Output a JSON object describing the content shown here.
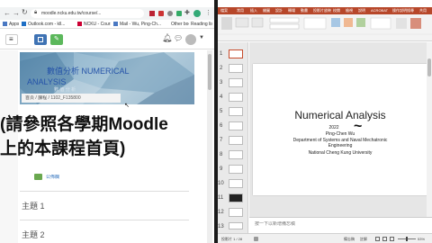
{
  "browser": {
    "url": "moodle.ncku.edu.tw/course/...",
    "bookmarks": [
      {
        "label": "Apps"
      },
      {
        "label": "Outlook.com - kll..."
      },
      {
        "label": "NCKU - Course"
      },
      {
        "label": "Mail - Wu, Ping-Ch..."
      }
    ],
    "other_bookmarks": "Other bookmarks",
    "reading_list": "Reading list"
  },
  "moodle": {
    "course_title_line1": "數值分析 NUMERICAL",
    "course_title_line2": "ANALYSIS",
    "course_title_faint": "數 值 分 析",
    "breadcrumb": "首頁 / 課程 / 1102_F135800",
    "overlay_line1": "(請參照各學期Moodle",
    "overlay_line2": "上的本課程首頁)",
    "forum_label": "公佈欄",
    "topic1": "主題 1",
    "topic2": "主題 2"
  },
  "ppt": {
    "ribbon_tabs": [
      "檔案",
      "常用",
      "插入",
      "繪圖",
      "設計",
      "轉場",
      "動畫",
      "投影片放映",
      "校閱",
      "檢視",
      "說明",
      "ACROBAT",
      "操作說明搜尋"
    ],
    "share_label": "共用",
    "slide_numbers": [
      "1",
      "2",
      "3",
      "4",
      "5",
      "6",
      "7",
      "8",
      "9",
      "10",
      "11",
      "12",
      "13"
    ],
    "slide_title": "Numerical Analysis",
    "slide_year": "2022",
    "slide_author": "Ping-Chen Wu",
    "slide_dept1": "Department of Systems and Naval Mechatronic",
    "slide_dept2": "Engineering",
    "slide_university": "National Cheng Kung University",
    "notes_placeholder": "按一下以新增備忘稿",
    "status_slide": "投影片 1 / 28",
    "status_notes": "備忘稿",
    "status_comments": "註解",
    "zoom": "53%"
  },
  "colors": {
    "ppt_orange": "#b7472a",
    "moodle_blue": "#3f73b4",
    "moodle_green": "#5cb85c"
  }
}
